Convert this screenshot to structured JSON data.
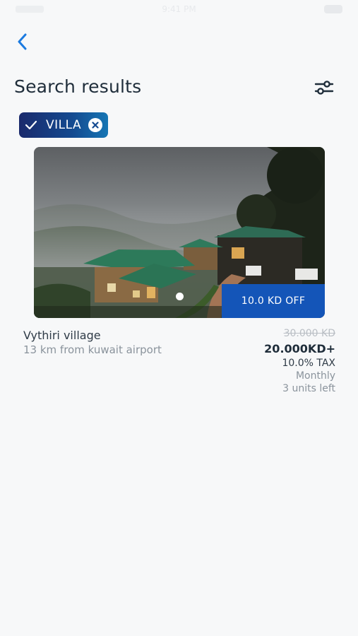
{
  "status_bar": {
    "time": "9:41 PM"
  },
  "header": {
    "title": "Search results"
  },
  "filters": {
    "chip_label": "VILLA"
  },
  "listing": {
    "discount": "10.0 KD OFF",
    "name": "Vythiri village",
    "distance": "13 km from kuwait airport",
    "old_price": "30.000 KD",
    "price": "20.000KD+",
    "tax": "10.0% TAX",
    "period": "Monthly",
    "units_left": "3 units left"
  },
  "icons": {
    "back": "chevron-left-icon",
    "filter": "sliders-icon",
    "check": "check-icon",
    "remove": "close-circle-icon"
  },
  "colors": {
    "accent": "#1455b8",
    "chip_start": "#1a2a6c",
    "chip_end": "#1676b4",
    "back_arrow": "#1c7be0"
  }
}
